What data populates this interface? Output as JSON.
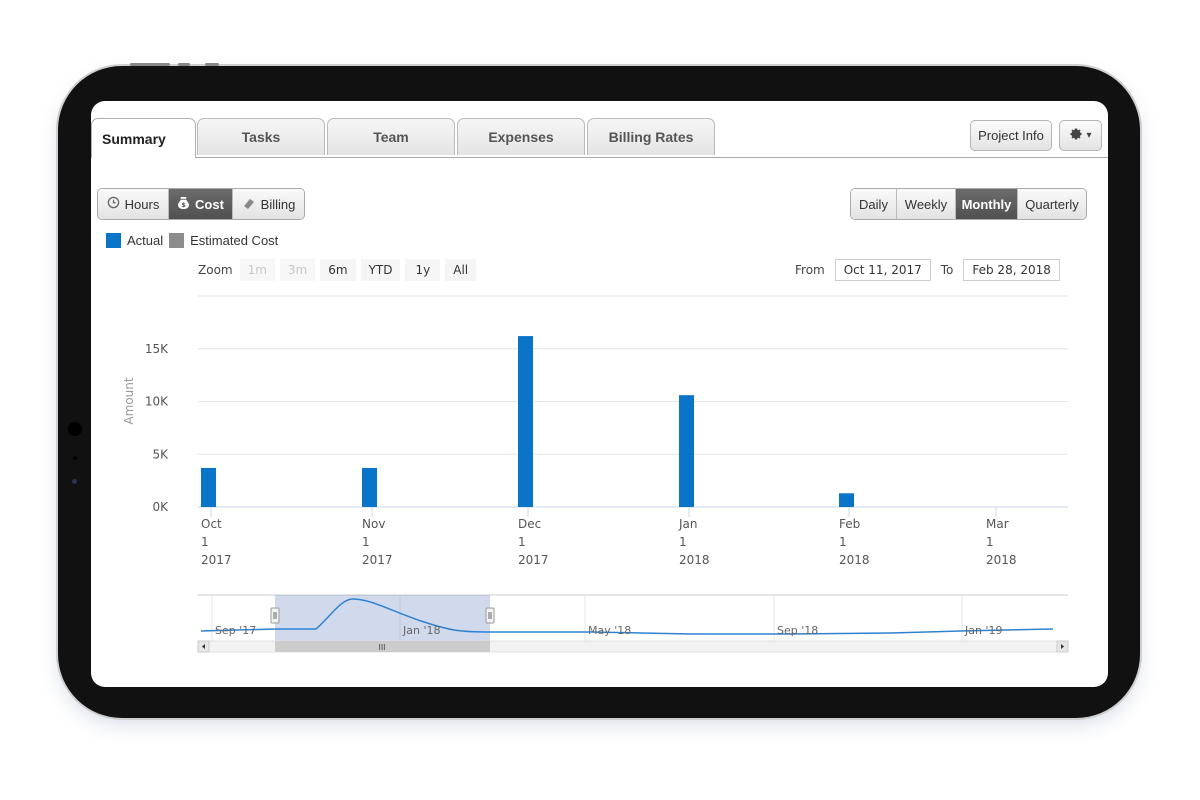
{
  "tabs": [
    {
      "label": "Summary",
      "active": true
    },
    {
      "label": "Tasks",
      "active": false
    },
    {
      "label": "Team",
      "active": false
    },
    {
      "label": "Expenses",
      "active": false
    },
    {
      "label": "Billing Rates",
      "active": false
    }
  ],
  "header": {
    "project_info_label": "Project Info",
    "settings_icon": "gear-icon",
    "settings_caret": "▾"
  },
  "metric_toggle": {
    "items": [
      {
        "label": "Hours",
        "icon": "clock-icon",
        "active": false
      },
      {
        "label": "Cost",
        "icon": "money-bag-icon",
        "active": true
      },
      {
        "label": "Billing",
        "icon": "tag-icon",
        "active": false
      }
    ]
  },
  "period_toggle": {
    "items": [
      {
        "label": "Daily",
        "active": false
      },
      {
        "label": "Weekly",
        "active": false
      },
      {
        "label": "Monthly",
        "active": true
      },
      {
        "label": "Quarterly",
        "active": false
      }
    ]
  },
  "legend": {
    "items": [
      {
        "label": "Actual",
        "color": "#0a74c9"
      },
      {
        "label": "Estimated Cost",
        "color": "#8c8c8c"
      }
    ]
  },
  "zoom": {
    "label": "Zoom",
    "buttons": [
      {
        "label": "1m",
        "enabled": false
      },
      {
        "label": "3m",
        "enabled": false
      },
      {
        "label": "6m",
        "enabled": true
      },
      {
        "label": "YTD",
        "enabled": true
      },
      {
        "label": "1y",
        "enabled": true
      },
      {
        "label": "All",
        "enabled": true
      }
    ]
  },
  "range": {
    "from_label": "From",
    "from_value": "Oct 11, 2017",
    "to_label": "To",
    "to_value": "Feb 28, 2018"
  },
  "chart_data": {
    "type": "bar",
    "title": "",
    "xlabel": "",
    "ylabel": "Amount",
    "ylim": [
      0,
      20000
    ],
    "yticks": [
      0,
      5000,
      10000,
      15000
    ],
    "ytick_labels": [
      "0K",
      "5K",
      "10K",
      "15K"
    ],
    "grid": true,
    "legend_position": "top-left",
    "categories": [
      "Oct 1 2017",
      "Nov 1 2017",
      "Dec 1 2017",
      "Jan 1 2018",
      "Feb 1 2018",
      "Mar 1 2018"
    ],
    "xtick_labels": [
      [
        "Oct",
        "1",
        "2017"
      ],
      [
        "Nov",
        "1",
        "2017"
      ],
      [
        "Dec",
        "1",
        "2017"
      ],
      [
        "Jan",
        "1",
        "2018"
      ],
      [
        "Feb",
        "1",
        "2018"
      ],
      [
        "Mar",
        "1",
        "2018"
      ]
    ],
    "series": [
      {
        "name": "Actual",
        "color": "#0a74c9",
        "values": [
          3700,
          3700,
          16200,
          10600,
          1300,
          0
        ]
      },
      {
        "name": "Estimated Cost",
        "color": "#8c8c8c",
        "values": [
          0,
          0,
          0,
          0,
          0,
          0
        ]
      }
    ],
    "navigator": {
      "labels": [
        "Sep '17",
        "Jan '18",
        "May '18",
        "Sep '18",
        "Jan '19"
      ],
      "selected_range": [
        "Oct 11, 2017",
        "Feb 28, 2018"
      ]
    }
  }
}
